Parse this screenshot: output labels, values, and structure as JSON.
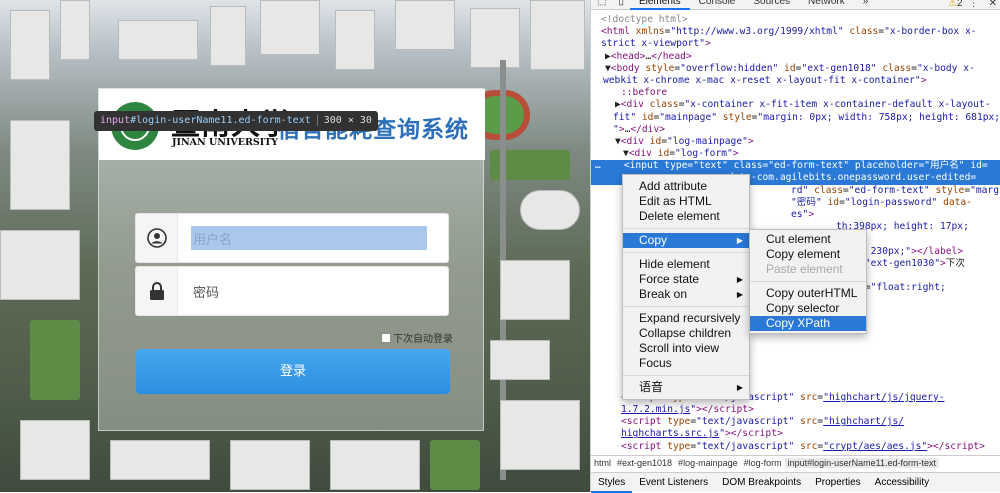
{
  "login": {
    "university_cn": "暨南大学",
    "university_en": "JINAN UNIVERSITY",
    "system_title": "宿舍能耗查询系统",
    "username_placeholder": "用户名",
    "password_placeholder": "密码",
    "remember_label": "下次自动登录",
    "login_button": "登录",
    "tooltip": {
      "tag": "input",
      "id": "#login-userName11",
      "cls": ".ed-form-text",
      "size": "300 × 30"
    }
  },
  "devtools": {
    "tabs": [
      "Elements",
      "Console",
      "Sources",
      "Network",
      "»"
    ],
    "warnings": "2",
    "breadcrumbs": [
      "html",
      "#ext-gen1018",
      "#log-mainpage",
      "#log-form",
      "input#login-userName11.ed-form-text"
    ],
    "bottom_tabs": [
      "Styles",
      "Event Listeners",
      "DOM Breakpoints",
      "Properties",
      "Accessibility"
    ],
    "context_menu": [
      "Add attribute",
      "Edit as HTML",
      "Delete element",
      "Copy",
      "Hide element",
      "Force state",
      "Break on",
      "Expand recursively",
      "Collapse children",
      "Scroll into view",
      "Focus",
      "语音"
    ],
    "copy_submenu": [
      "Cut element",
      "Copy element",
      "Paste element",
      "Copy outerHTML",
      "Copy selector",
      "Copy XPath"
    ]
  }
}
